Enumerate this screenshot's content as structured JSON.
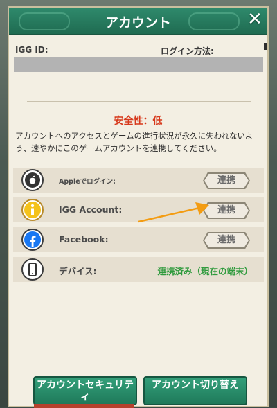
{
  "dialog": {
    "title": "アカウント",
    "close_icon": "close-x-icon"
  },
  "account": {
    "igg_id_label": "IGG ID:",
    "login_method_label": "ログイン方法:",
    "safety_text": "安全性：低",
    "description": "アカウントへのアクセスとゲームの進行状況が永久に失われないよう、速やかにこのゲームアカウントを連携してください。"
  },
  "rows": [
    {
      "name": "Appleでログイン:",
      "icon": "apple-icon",
      "action": "連携"
    },
    {
      "name": "IGG Account:",
      "icon": "igg-icon",
      "action": "連携"
    },
    {
      "name": "Facebook:",
      "icon": "facebook-icon",
      "action": "連携"
    },
    {
      "name": "デバイス:",
      "icon": "device-icon",
      "status": "連携済み（現在の端末）"
    }
  ],
  "buttons": {
    "security_label": "アカウントセキュリティ",
    "switch_label": "アカウント切り替え"
  },
  "colors": {
    "header": "#2a7d60",
    "safety_red": "#d73a1d",
    "linked_green": "#2e9a3c",
    "arrow": "#f39c12"
  }
}
